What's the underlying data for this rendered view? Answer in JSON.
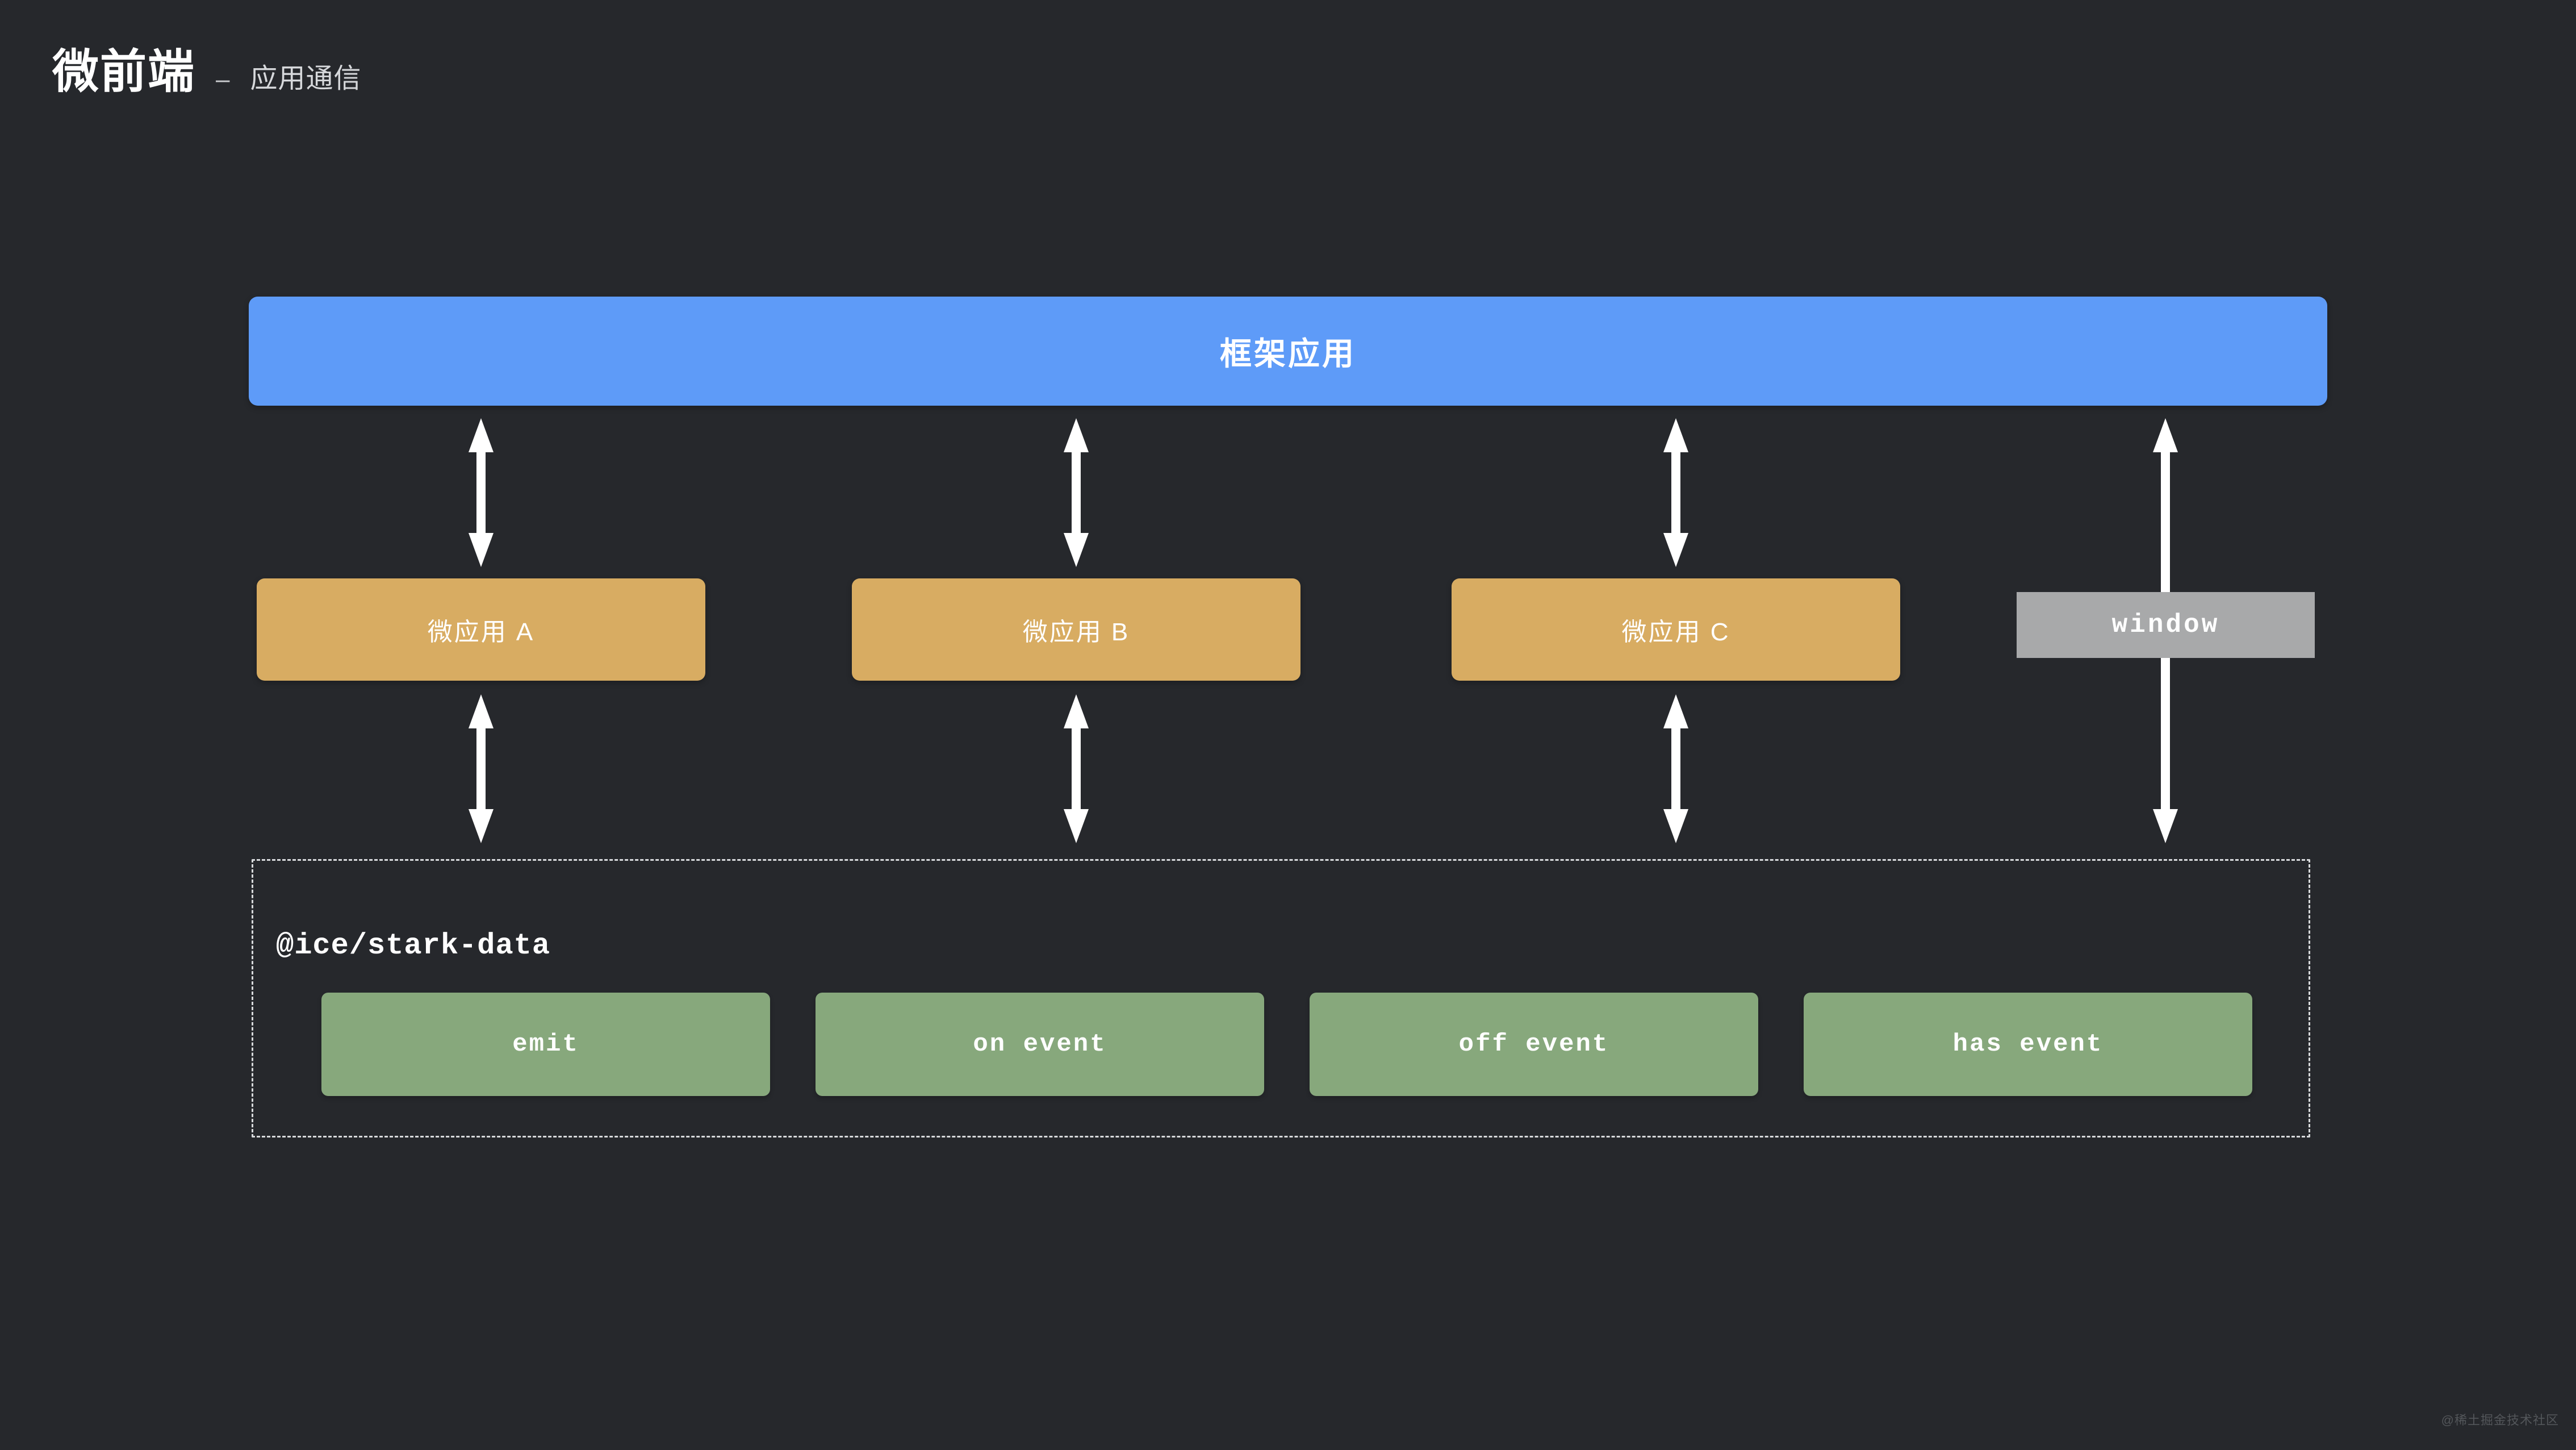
{
  "header": {
    "title": "微前端",
    "separator": "–",
    "subtitle": "应用通信"
  },
  "framework": {
    "label": "框架应用",
    "color": "#5E9BF8"
  },
  "microapps": [
    {
      "label": "微应用 A",
      "color": "#D8AC62"
    },
    {
      "label": "微应用 B",
      "color": "#D8AC62"
    },
    {
      "label": "微应用 C",
      "color": "#D8AC62"
    }
  ],
  "window_box": {
    "label": "window",
    "color": "#A8A9AA"
  },
  "stark_data": {
    "title": "@ice/stark-data",
    "border_color": "#D8DADC",
    "events": [
      {
        "label": "emit",
        "color": "#87A87C"
      },
      {
        "label": "on event",
        "color": "#87A87C"
      },
      {
        "label": "off event",
        "color": "#87A87C"
      },
      {
        "label": "has event",
        "color": "#87A87C"
      }
    ]
  },
  "arrows": {
    "icon": "double-headed-vertical-arrow",
    "color": "#FFFFFF",
    "count": 7
  },
  "background_color": "#26282C",
  "watermark": "@稀土掘金技术社区"
}
